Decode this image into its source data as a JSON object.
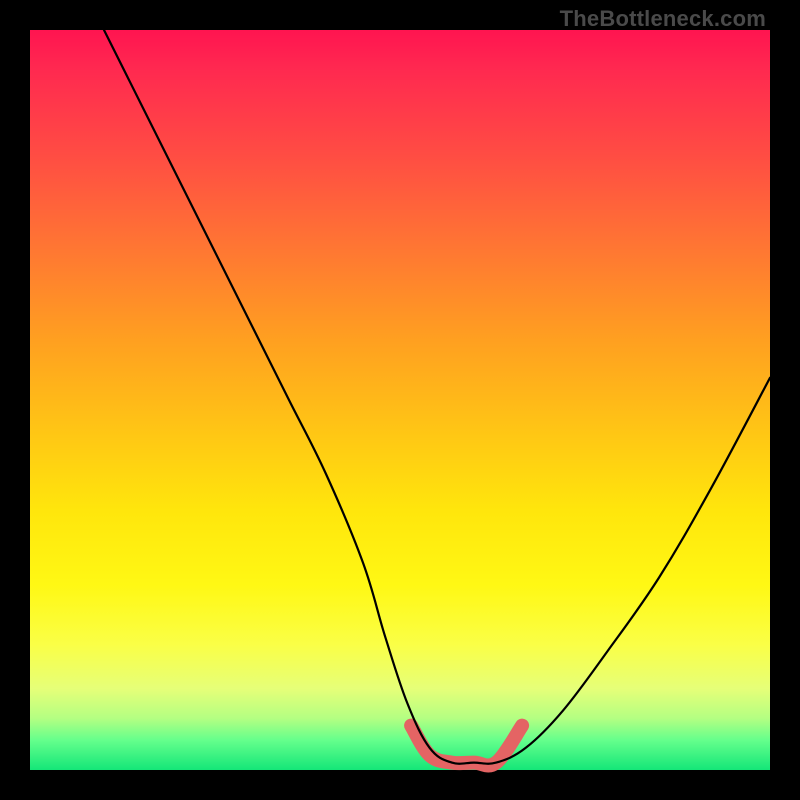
{
  "attribution": "TheBottleneck.com",
  "chart_data": {
    "type": "line",
    "title": "",
    "xlabel": "",
    "ylabel": "",
    "xlim": [
      0,
      100
    ],
    "ylim": [
      0,
      100
    ],
    "series": [
      {
        "name": "bottleneck-curve",
        "x": [
          10,
          15,
          20,
          25,
          30,
          35,
          40,
          45,
          48,
          51,
          54,
          57,
          60,
          63,
          67,
          72,
          78,
          85,
          92,
          100
        ],
        "values": [
          100,
          90,
          80,
          70,
          60,
          50,
          40,
          28,
          18,
          9,
          3,
          1,
          1,
          1,
          3,
          8,
          16,
          26,
          38,
          53
        ]
      },
      {
        "name": "optimal-band",
        "x": [
          51.5,
          54,
          57,
          60,
          63,
          66.5
        ],
        "values": [
          6,
          2,
          1,
          1,
          1,
          6
        ]
      }
    ],
    "colors": {
      "curve": "#000000",
      "band": "#e46464"
    }
  }
}
